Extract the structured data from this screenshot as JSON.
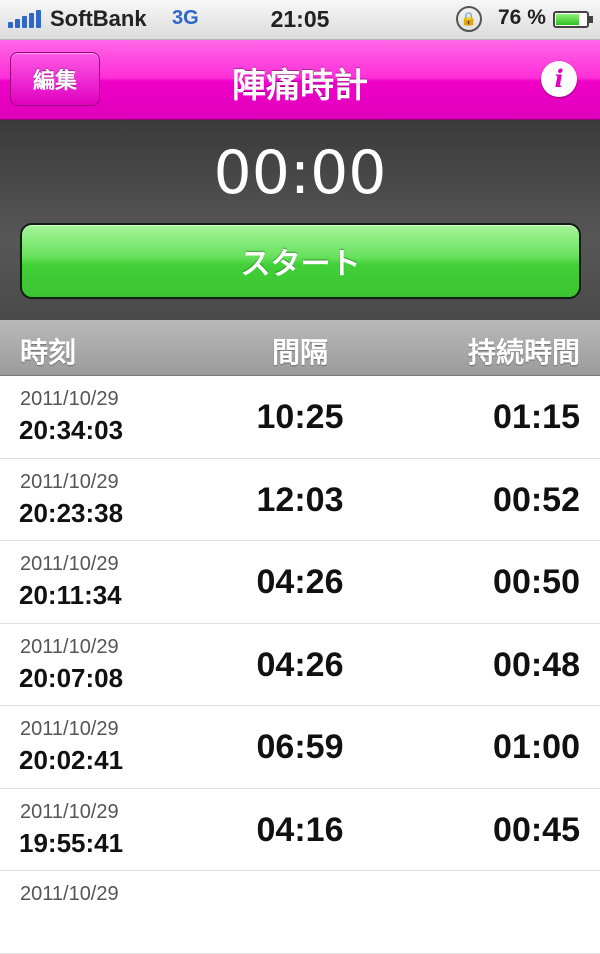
{
  "status_bar": {
    "carrier": "SoftBank",
    "network": "3G",
    "time": "21:05",
    "battery": "76 %",
    "battery_level": 0.76,
    "icons": [
      "signal-icon",
      "rotation-lock-icon",
      "battery-icon"
    ]
  },
  "nav": {
    "edit_label": "編集",
    "title": "陣痛時計",
    "info_label": "i",
    "accent_color": "#f000c8"
  },
  "timer": {
    "display": "00:00",
    "start_label": "スタート",
    "start_color": "#42cf38"
  },
  "columns": {
    "time": "時刻",
    "interval": "間隔",
    "duration": "持続時間"
  },
  "records": [
    {
      "date": "2011/10/29",
      "time": "20:34:03",
      "interval": "10:25",
      "duration": "01:15"
    },
    {
      "date": "2011/10/29",
      "time": "20:23:38",
      "interval": "12:03",
      "duration": "00:52"
    },
    {
      "date": "2011/10/29",
      "time": "20:11:34",
      "interval": "04:26",
      "duration": "00:50"
    },
    {
      "date": "2011/10/29",
      "time": "20:07:08",
      "interval": "04:26",
      "duration": "00:48"
    },
    {
      "date": "2011/10/29",
      "time": "20:02:41",
      "interval": "06:59",
      "duration": "01:00"
    },
    {
      "date": "2011/10/29",
      "time": "19:55:41",
      "interval": "04:16",
      "duration": "00:45"
    },
    {
      "date": "2011/10/29",
      "time": "",
      "interval": "",
      "duration": ""
    }
  ]
}
